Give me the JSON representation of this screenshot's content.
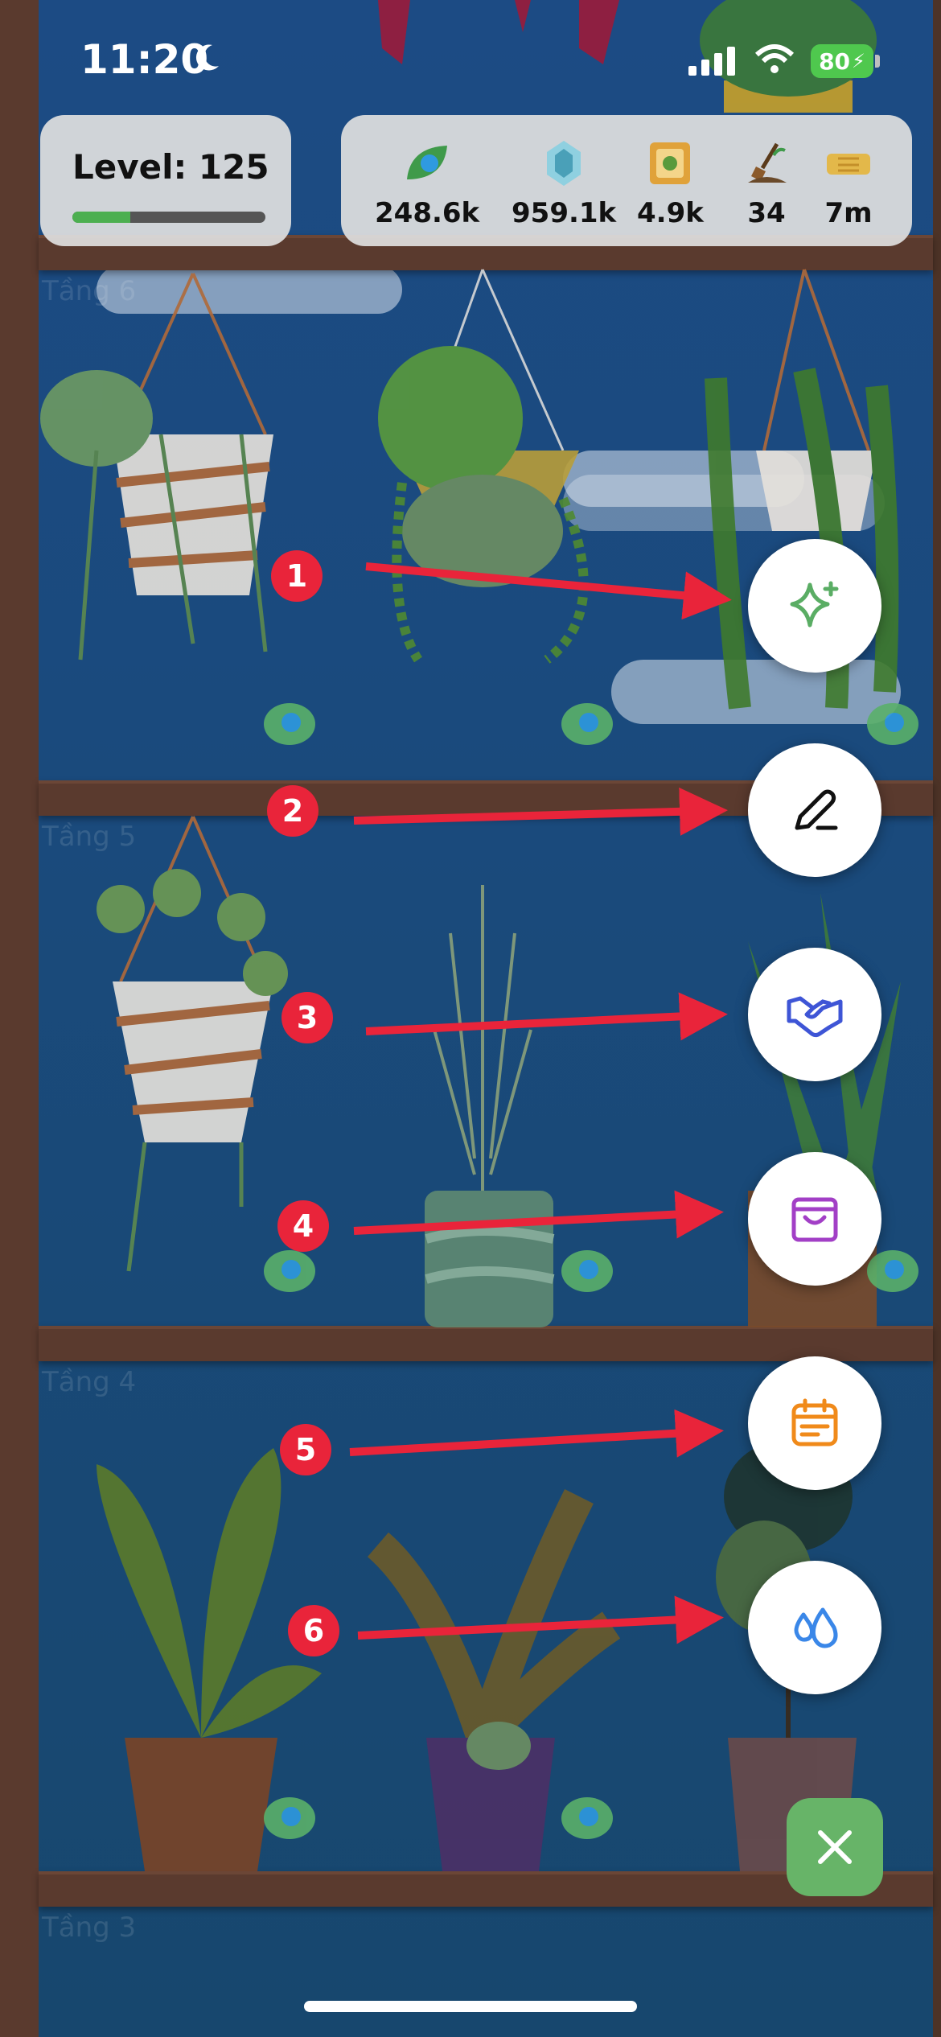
{
  "status_bar": {
    "time": "11:20",
    "battery": "80"
  },
  "header": {
    "level_label": "Level: 125",
    "level_progress": 0.3,
    "stats": [
      {
        "icon": "oxygen-leaf-icon",
        "value": "248.6k"
      },
      {
        "icon": "gem-icon",
        "value": "959.1k"
      },
      {
        "icon": "seed-frame-icon",
        "value": "4.9k"
      },
      {
        "icon": "shovel-icon",
        "value": "34"
      },
      {
        "icon": "ticket-icon",
        "value": "7m"
      }
    ]
  },
  "floors": [
    "Tầng 6",
    "Tầng 5",
    "Tầng 4",
    "Tầng 3"
  ],
  "fab_menu": {
    "items": [
      {
        "icon": "sparkle-icon",
        "badge": "1",
        "color": "#5aad64"
      },
      {
        "icon": "pencil-icon",
        "badge": "2",
        "color": "#111111"
      },
      {
        "icon": "handshake-icon",
        "badge": "3",
        "color": "#3e55d6"
      },
      {
        "icon": "shopping-bag-icon",
        "badge": "4",
        "color": "#a23fc6"
      },
      {
        "icon": "calendar-icon",
        "badge": "5",
        "color": "#f08a1a"
      },
      {
        "icon": "water-drops-icon",
        "badge": "6",
        "color": "#3a87e8"
      }
    ],
    "close_icon": "close-icon"
  },
  "colors": {
    "annotation": "#e9243a",
    "shelf": "#5a3a2e",
    "close_button": "#67b468"
  }
}
